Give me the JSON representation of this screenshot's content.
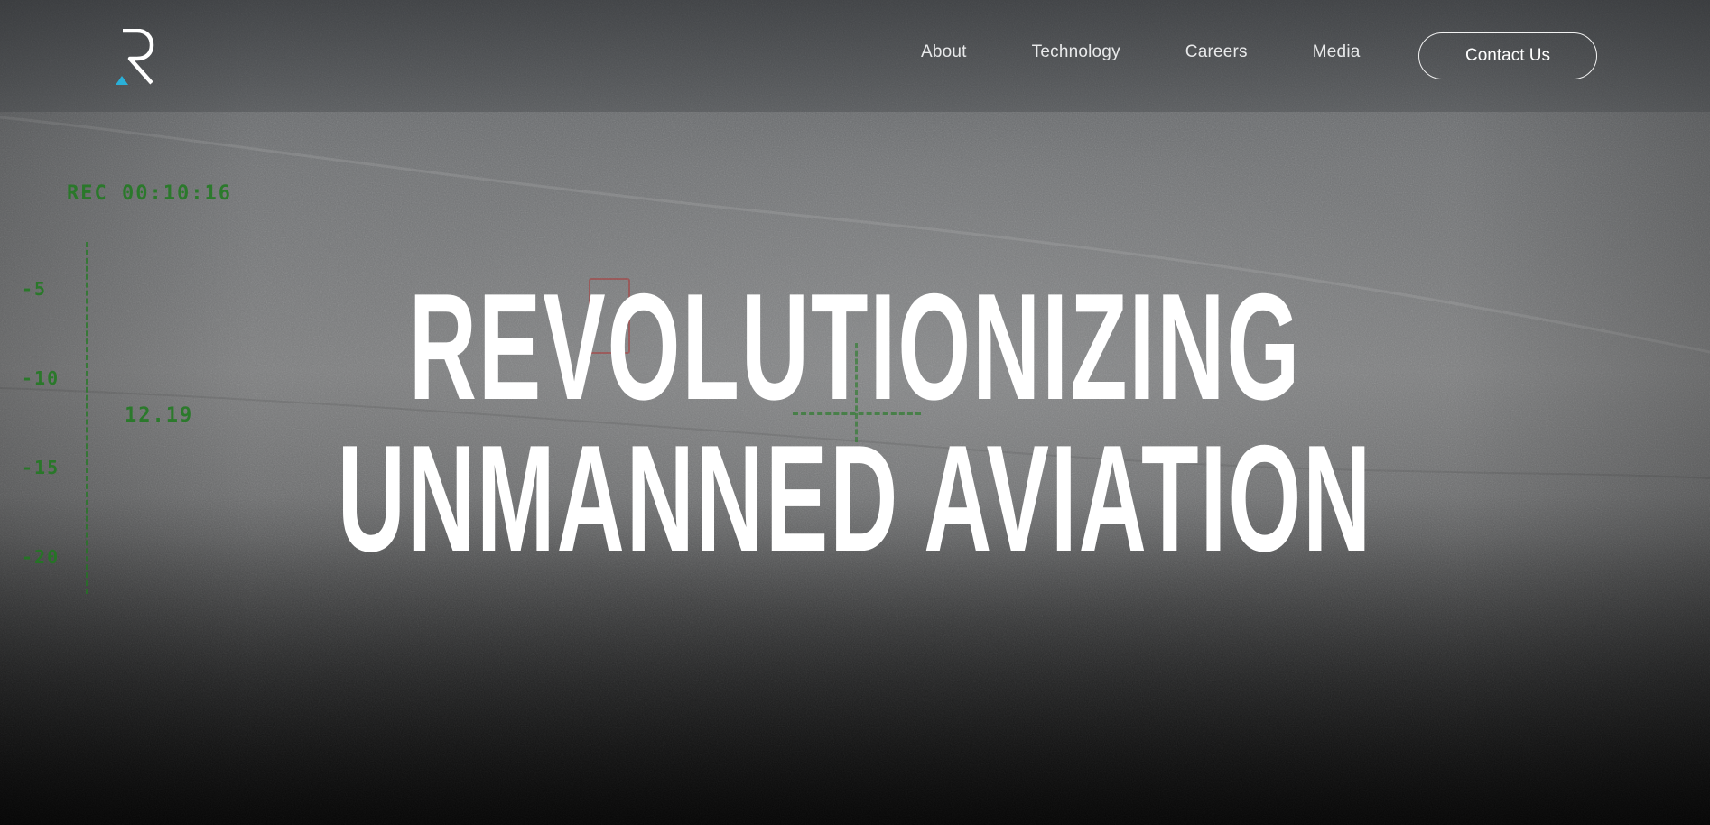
{
  "header": {
    "logo_icon": "r-monogram-logo",
    "nav": [
      {
        "label": "About"
      },
      {
        "label": "Technology"
      },
      {
        "label": "Careers"
      },
      {
        "label": "Media"
      }
    ],
    "contact_label": "Contact Us"
  },
  "hero": {
    "headline_line1": "REVOLUTIONIZING",
    "headline_line2": "UNMANNED AVIATION"
  },
  "hud": {
    "rec": "REC 00:10:16",
    "scale_labels": [
      "-5",
      "-10",
      "-15",
      "-20"
    ],
    "bearing": "12.19",
    "color": "#1f7a1f"
  },
  "colors": {
    "accent": "#2ab0d8",
    "text": "#ffffff"
  }
}
